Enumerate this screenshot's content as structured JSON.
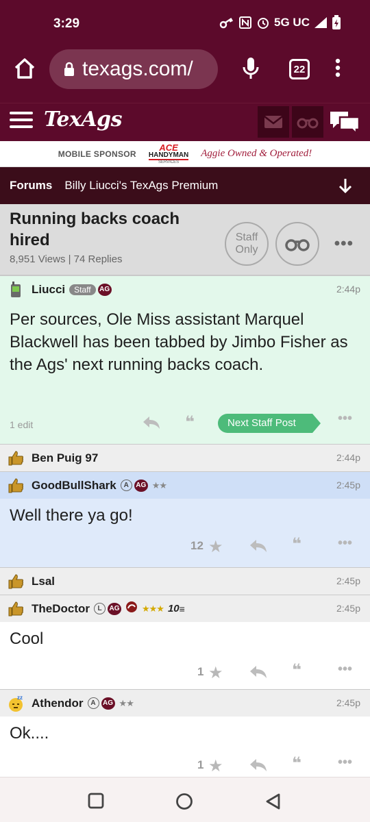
{
  "status_bar": {
    "time": "3:29",
    "network": "5G UC"
  },
  "browser": {
    "url": "texags.com/",
    "tab_count": "22"
  },
  "site": {
    "logo": "TexAgs"
  },
  "sponsor": {
    "label": "MOBILE SPONSOR",
    "logo_top": "ACE",
    "logo_mid": "HANDYMAN",
    "logo_bottom": "SERVICES",
    "tagline": "Aggie Owned & Operated!"
  },
  "forum_bar": {
    "forums": "Forums",
    "subforum": "Billy Liucci's TexAgs Premium"
  },
  "thread": {
    "title": "Running backs coach hired",
    "meta": "8,951 Views | 74 Replies",
    "staff_only": "Staff Only"
  },
  "posts": [
    {
      "username": "Liucci",
      "staff_badge": "Staff",
      "ag_badge": "AG",
      "time": "2:44p",
      "body": "Per sources, Ole Miss assistant Marquel Blackwell has been tabbed by Jimbo Fisher as the Ags' next running backs coach.",
      "edit_note": "1 edit",
      "next_staff": "Next Staff Post",
      "bg": "#e3f8eb"
    },
    {
      "username": "Ben Puig 97",
      "time": "2:44p",
      "bg": "#eeeeee"
    },
    {
      "username": "GoodBullShark",
      "circle_badge": "A",
      "ag_badge": "AG",
      "stars": "★★",
      "time": "2:45p",
      "body": "Well there ya go!",
      "star_count": "12",
      "bg": "#dfeafa",
      "head_bg": "#cfdff7"
    },
    {
      "username": "Lsal",
      "time": "2:45p",
      "bg": "#eeeeee"
    },
    {
      "username": "TheDoctor",
      "circle_badge": "L",
      "ag_badge": "AG",
      "stars": "★★★",
      "class_badge": "10",
      "time": "2:45p",
      "body": "Cool",
      "star_count": "1",
      "bg": "#ffffff",
      "head_bg": "#eeeeee"
    },
    {
      "username": "Athendor",
      "circle_badge": "A",
      "ag_badge": "AG",
      "stars": "★★",
      "time": "2:45p",
      "body": "Ok....",
      "star_count": "1",
      "bg": "#ffffff",
      "head_bg": "#eeeeee"
    }
  ],
  "colors": {
    "maroon": "#5c0a2b",
    "staff_green": "#4dbb7a"
  }
}
